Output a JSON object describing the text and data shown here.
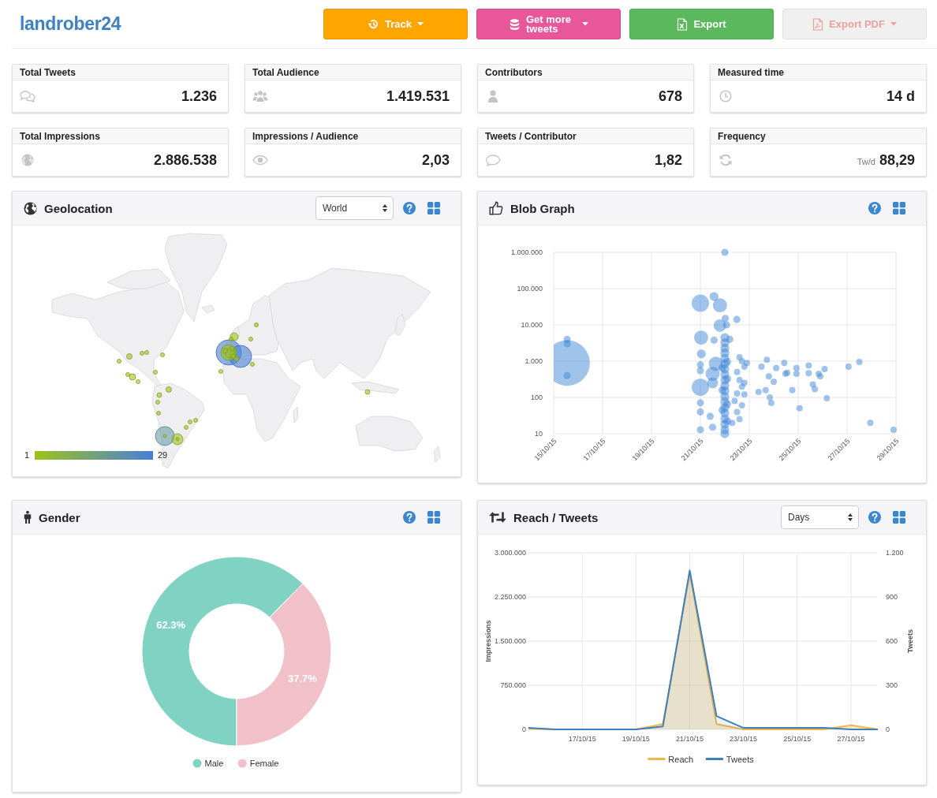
{
  "header": {
    "logo": "landrober24",
    "track_button": {
      "label": "Track",
      "dropdown": true,
      "disabled": false
    },
    "more_button": {
      "label": "Get more tweets",
      "dropdown": true,
      "disabled": false
    },
    "export_button": {
      "label": "Export",
      "dropdown": false,
      "disabled": false
    },
    "pdf_button": {
      "label": "Export PDF",
      "dropdown": true,
      "disabled": true
    }
  },
  "stats": [
    {
      "label": "Total Tweets",
      "value": "1.236"
    },
    {
      "label": "Total Audience",
      "value": "1.419.531"
    },
    {
      "label": "Contributors",
      "value": "678"
    },
    {
      "label": "Measured time",
      "value": "14 d"
    },
    {
      "label": "Total Impressions",
      "value": "2.886.538"
    },
    {
      "label": "Impressions / Audience",
      "value": "2,03"
    },
    {
      "label": "Tweets / Contributor",
      "value": "1,82"
    },
    {
      "label": "Frequency",
      "unit": "Tw/d",
      "value": "88,29"
    }
  ],
  "geolocation": {
    "title": "Geolocation",
    "region_select": {
      "value": "World"
    },
    "scale": {
      "min_label": "1",
      "max_label": "29"
    }
  },
  "blob_graph": {
    "title": "Blob Graph",
    "y_labels": [
      "1.000.000",
      "100.000",
      "10.000",
      "1.000",
      "100",
      "10"
    ],
    "x_labels": [
      "15/10/15",
      "17/10/15",
      "19/10/15",
      "21/10/15",
      "23/10/15",
      "25/10/15",
      "27/10/15",
      "29/10/15"
    ]
  },
  "gender": {
    "title": "Gender",
    "chart_data": {
      "type": "donut",
      "categories": [
        "Male",
        "Female"
      ],
      "values": [
        62.3,
        37.7
      ],
      "colors": [
        "#80d3c3",
        "#f2c0c8"
      ],
      "value_labels": [
        "62.3%",
        "37.7%"
      ],
      "legend": "bottom"
    }
  },
  "reach_tweets": {
    "title": "Reach / Tweets",
    "interval_select": {
      "value": "Days"
    },
    "chart_data": {
      "type": "area",
      "grid": true,
      "categories": [
        null,
        null,
        "17/10/15",
        null,
        "19/10/15",
        null,
        "21/10/15",
        null,
        "23/10/15",
        null,
        "25/10/15",
        null,
        "27/10/15",
        null
      ],
      "series": [
        {
          "name": "Reach",
          "color": "#f0b849",
          "values": [
            10000,
            0,
            0,
            0,
            0,
            90000,
            2650000,
            90000,
            0,
            0,
            0,
            0,
            70000,
            0
          ]
        },
        {
          "name": "Tweets",
          "color": "#3d7fbf",
          "axis": "y2",
          "values": [
            10,
            0,
            0,
            0,
            0,
            20,
            1080,
            90,
            10,
            10,
            10,
            10,
            0,
            0
          ]
        }
      ],
      "ylim": [
        0,
        3000000
      ],
      "y2lim": [
        0,
        1200
      ],
      "ylabel": "Impressions",
      "y2label": "Tweets",
      "yticks": [
        0,
        {
          "value": 750000,
          "label": "750.000"
        },
        {
          "value": 1500000,
          "label": "1.500.000"
        },
        {
          "value": 2250000,
          "label": "2.250.000"
        },
        {
          "value": 3000000,
          "label": "3.000.000"
        }
      ],
      "y2ticks": [
        0,
        300,
        600,
        900,
        {
          "value": 1200,
          "label": "1.200"
        }
      ],
      "legend": "bottom"
    }
  }
}
